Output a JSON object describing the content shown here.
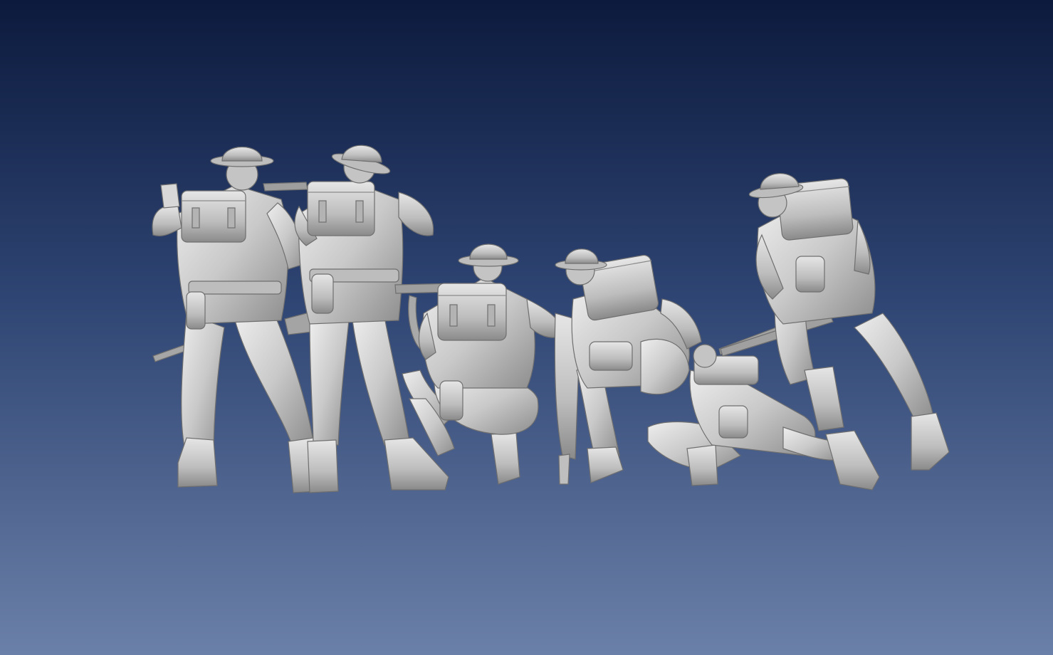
{
  "scene": {
    "background": {
      "top_color": "#0c1a3d",
      "mid_color": "#2e4472",
      "bottom_color": "#6b80a8"
    },
    "figure_color": "#c9c9c9",
    "figure_shadow_color": "#8d8d8d",
    "figure_highlight_color": "#eeeeee",
    "figures": [
      {
        "pose": "standing-aiming"
      },
      {
        "pose": "standing-aiming"
      },
      {
        "pose": "kneeling-aiming"
      },
      {
        "pose": "crouching"
      },
      {
        "pose": "prone-crawling"
      },
      {
        "pose": "advancing-with-rifle"
      }
    ]
  }
}
